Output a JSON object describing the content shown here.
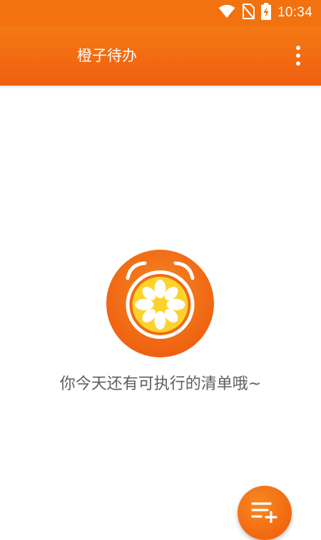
{
  "status_bar": {
    "time": "10:34",
    "icons": [
      "wifi-icon",
      "no-sim-icon",
      "battery-charging-icon"
    ]
  },
  "app_bar": {
    "title": "橙子待办",
    "menu_icon": "more-vert-icon"
  },
  "empty_state": {
    "logo_icon": "orange-alarm-clock-logo",
    "message": "你今天还有可执行的清单哦~"
  },
  "fab": {
    "icon": "add-list-icon"
  },
  "colors": {
    "primary": "#f2720f",
    "background": "#ffffff",
    "text_secondary": "#5e5e5e",
    "logo_yellow": "#fbd32e"
  }
}
